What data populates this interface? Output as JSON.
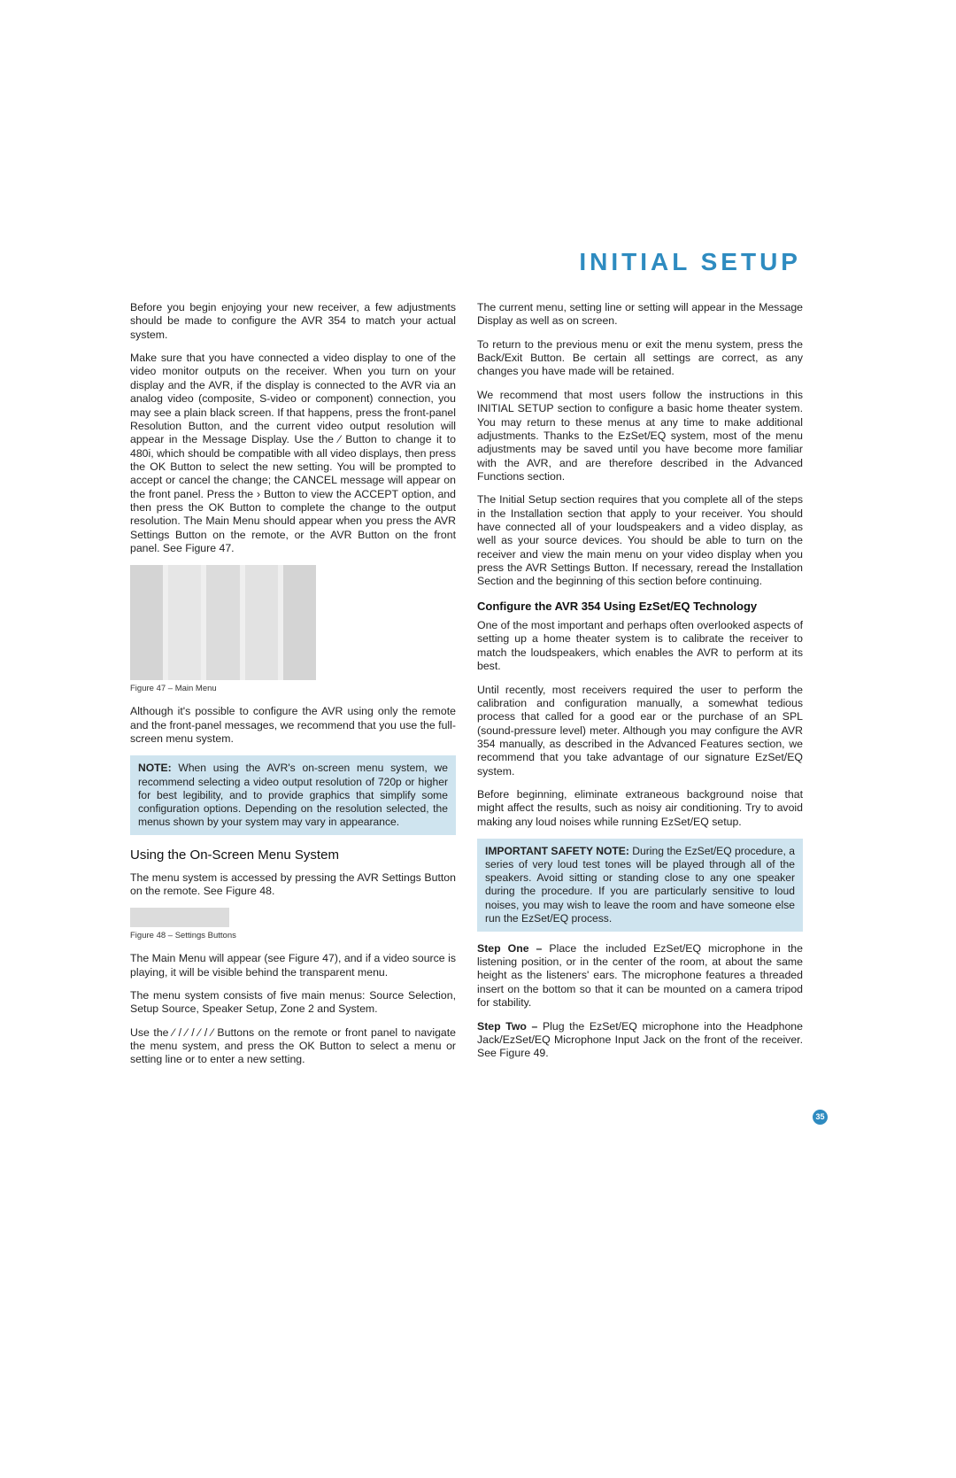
{
  "title": "INITIAL SETUP",
  "page_number": "35",
  "left": {
    "p1": "Before you begin enjoying your new receiver, a few adjustments should be made to configure the AVR 354 to match your actual system.",
    "p2": "Make sure that you have connected a video display to one of the video monitor outputs on the receiver. When you turn on your display and the AVR, if the display is connected to the AVR via an analog video (composite, S-video or component) connection, you may see a plain black screen. If that happens, press the front-panel Resolution Button, and the current video output resolution will appear in the Message Display. Use the ⁄ Button to change it to 480i, which should be compatible with all video displays, then press the OK Button to select the new setting. You will be prompted to accept or cancel the change; the CANCEL message will appear on the front panel. Press the › Button to view the ACCEPT option, and then press the OK Button to complete the change to the output resolution. The Main Menu should appear when you press the AVR Settings Button on the remote, or the AVR Button on the front panel. See Figure 47.",
    "fig47cap": "Figure 47 – Main Menu",
    "p3": "Although it's possible to configure the AVR using only the remote and the front-panel messages, we recommend that you use the full-screen menu system.",
    "note1_bold": "NOTE:",
    "note1_body": " When using the AVR's on-screen menu system, we recommend selecting a video output resolution of 720p or higher for best legibility, and to provide graphics that simplify some configuration options. Depending on the resolution selected, the menus shown by your system may vary in appearance.",
    "subhead1": "Using the On-Screen Menu System",
    "p4": "The menu system is accessed by pressing the AVR Settings Button on the remote. See Figure 48.",
    "fig48cap": "Figure 48 – Settings Buttons",
    "p5": "The Main Menu will appear (see Figure 47), and if a video source is playing, it will be visible behind the transparent menu.",
    "p6": "The menu system consists of five main menus: Source Selection, Setup Source, Speaker Setup, Zone 2 and System.",
    "p7": "Use the ⁄ / ⁄ / ⁄ / ⁄ Buttons on the remote or front panel to navigate the menu system, and press the OK Button to select a menu or setting line or to enter a new setting."
  },
  "right": {
    "p1": "The current menu, setting line or setting will appear in the Message Display as well as on screen.",
    "p2": "To return to the previous menu or exit the menu system, press the Back/Exit Button. Be certain all settings are correct, as any changes you have made will be retained.",
    "p3": "We recommend that most users follow the instructions in this INITIAL SETUP section to configure a basic home theater system. You may return to these menus at any time to make additional adjustments. Thanks to the EzSet/EQ system, most of the menu adjustments may be saved until you have become more familiar with the AVR, and are therefore described in the Advanced Functions section.",
    "p4": "The Initial Setup section requires that you complete all of the steps in the Installation section that apply to your receiver. You should have connected all of your loudspeakers and a video display, as well as your source devices. You should be able to turn on the receiver and view the main menu on your video display when you press the AVR Settings Button. If necessary, reread the Installation Section and the beginning of this section before continuing.",
    "subhead2": "Configure the AVR 354 Using EzSet/EQ Technology",
    "p5": "One of the most important and perhaps often overlooked aspects of setting up a home theater system is to calibrate the receiver to match the loudspeakers, which enables the AVR to perform at its best.",
    "p6": "Until recently, most receivers required the user to perform the calibration and configuration manually, a somewhat tedious process that called for a good ear or the purchase of an SPL (sound-pressure level) meter. Although you may configure the AVR 354 manually, as described in the Advanced Features section, we recommend that you take advantage of our signature EzSet/EQ system.",
    "p7": "Before beginning, eliminate extraneous background noise that might affect the results, such as noisy air conditioning. Try to avoid making any loud noises while running EzSet/EQ setup.",
    "note2_bold": "IMPORTANT SAFETY NOTE:",
    "note2_body": " During the EzSet/EQ procedure, a series of very loud test tones will be played through all of the speakers. Avoid sitting or standing close to any one speaker during the procedure. If you are particularly sensitive to loud noises, you may wish to leave the room and have someone else run the EzSet/EQ process.",
    "step1_bold": "Step One –",
    "step1_body": " Place the included EzSet/EQ microphone in the listening position, or in the center of the room, at about the same height as the listeners' ears. The microphone features a threaded insert on the bottom so that it can be mounted on a camera tripod for stability.",
    "step2_bold": "Step Two –",
    "step2_body": " Plug the EzSet/EQ microphone into the Headphone Jack/EzSet/EQ Microphone Input Jack on the front of the receiver. See Figure 49."
  }
}
